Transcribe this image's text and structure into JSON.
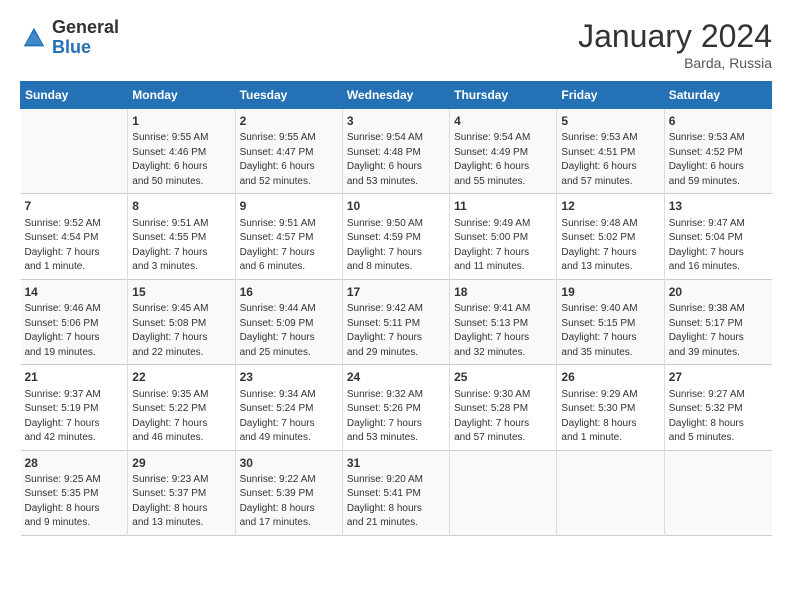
{
  "logo": {
    "general": "General",
    "blue": "Blue"
  },
  "title": "January 2024",
  "location": "Barda, Russia",
  "days_header": [
    "Sunday",
    "Monday",
    "Tuesday",
    "Wednesday",
    "Thursday",
    "Friday",
    "Saturday"
  ],
  "weeks": [
    [
      {
        "day": "",
        "info": ""
      },
      {
        "day": "1",
        "info": "Sunrise: 9:55 AM\nSunset: 4:46 PM\nDaylight: 6 hours\nand 50 minutes."
      },
      {
        "day": "2",
        "info": "Sunrise: 9:55 AM\nSunset: 4:47 PM\nDaylight: 6 hours\nand 52 minutes."
      },
      {
        "day": "3",
        "info": "Sunrise: 9:54 AM\nSunset: 4:48 PM\nDaylight: 6 hours\nand 53 minutes."
      },
      {
        "day": "4",
        "info": "Sunrise: 9:54 AM\nSunset: 4:49 PM\nDaylight: 6 hours\nand 55 minutes."
      },
      {
        "day": "5",
        "info": "Sunrise: 9:53 AM\nSunset: 4:51 PM\nDaylight: 6 hours\nand 57 minutes."
      },
      {
        "day": "6",
        "info": "Sunrise: 9:53 AM\nSunset: 4:52 PM\nDaylight: 6 hours\nand 59 minutes."
      }
    ],
    [
      {
        "day": "7",
        "info": "Sunrise: 9:52 AM\nSunset: 4:54 PM\nDaylight: 7 hours\nand 1 minute."
      },
      {
        "day": "8",
        "info": "Sunrise: 9:51 AM\nSunset: 4:55 PM\nDaylight: 7 hours\nand 3 minutes."
      },
      {
        "day": "9",
        "info": "Sunrise: 9:51 AM\nSunset: 4:57 PM\nDaylight: 7 hours\nand 6 minutes."
      },
      {
        "day": "10",
        "info": "Sunrise: 9:50 AM\nSunset: 4:59 PM\nDaylight: 7 hours\nand 8 minutes."
      },
      {
        "day": "11",
        "info": "Sunrise: 9:49 AM\nSunset: 5:00 PM\nDaylight: 7 hours\nand 11 minutes."
      },
      {
        "day": "12",
        "info": "Sunrise: 9:48 AM\nSunset: 5:02 PM\nDaylight: 7 hours\nand 13 minutes."
      },
      {
        "day": "13",
        "info": "Sunrise: 9:47 AM\nSunset: 5:04 PM\nDaylight: 7 hours\nand 16 minutes."
      }
    ],
    [
      {
        "day": "14",
        "info": "Sunrise: 9:46 AM\nSunset: 5:06 PM\nDaylight: 7 hours\nand 19 minutes."
      },
      {
        "day": "15",
        "info": "Sunrise: 9:45 AM\nSunset: 5:08 PM\nDaylight: 7 hours\nand 22 minutes."
      },
      {
        "day": "16",
        "info": "Sunrise: 9:44 AM\nSunset: 5:09 PM\nDaylight: 7 hours\nand 25 minutes."
      },
      {
        "day": "17",
        "info": "Sunrise: 9:42 AM\nSunset: 5:11 PM\nDaylight: 7 hours\nand 29 minutes."
      },
      {
        "day": "18",
        "info": "Sunrise: 9:41 AM\nSunset: 5:13 PM\nDaylight: 7 hours\nand 32 minutes."
      },
      {
        "day": "19",
        "info": "Sunrise: 9:40 AM\nSunset: 5:15 PM\nDaylight: 7 hours\nand 35 minutes."
      },
      {
        "day": "20",
        "info": "Sunrise: 9:38 AM\nSunset: 5:17 PM\nDaylight: 7 hours\nand 39 minutes."
      }
    ],
    [
      {
        "day": "21",
        "info": "Sunrise: 9:37 AM\nSunset: 5:19 PM\nDaylight: 7 hours\nand 42 minutes."
      },
      {
        "day": "22",
        "info": "Sunrise: 9:35 AM\nSunset: 5:22 PM\nDaylight: 7 hours\nand 46 minutes."
      },
      {
        "day": "23",
        "info": "Sunrise: 9:34 AM\nSunset: 5:24 PM\nDaylight: 7 hours\nand 49 minutes."
      },
      {
        "day": "24",
        "info": "Sunrise: 9:32 AM\nSunset: 5:26 PM\nDaylight: 7 hours\nand 53 minutes."
      },
      {
        "day": "25",
        "info": "Sunrise: 9:30 AM\nSunset: 5:28 PM\nDaylight: 7 hours\nand 57 minutes."
      },
      {
        "day": "26",
        "info": "Sunrise: 9:29 AM\nSunset: 5:30 PM\nDaylight: 8 hours\nand 1 minute."
      },
      {
        "day": "27",
        "info": "Sunrise: 9:27 AM\nSunset: 5:32 PM\nDaylight: 8 hours\nand 5 minutes."
      }
    ],
    [
      {
        "day": "28",
        "info": "Sunrise: 9:25 AM\nSunset: 5:35 PM\nDaylight: 8 hours\nand 9 minutes."
      },
      {
        "day": "29",
        "info": "Sunrise: 9:23 AM\nSunset: 5:37 PM\nDaylight: 8 hours\nand 13 minutes."
      },
      {
        "day": "30",
        "info": "Sunrise: 9:22 AM\nSunset: 5:39 PM\nDaylight: 8 hours\nand 17 minutes."
      },
      {
        "day": "31",
        "info": "Sunrise: 9:20 AM\nSunset: 5:41 PM\nDaylight: 8 hours\nand 21 minutes."
      },
      {
        "day": "",
        "info": ""
      },
      {
        "day": "",
        "info": ""
      },
      {
        "day": "",
        "info": ""
      }
    ]
  ]
}
